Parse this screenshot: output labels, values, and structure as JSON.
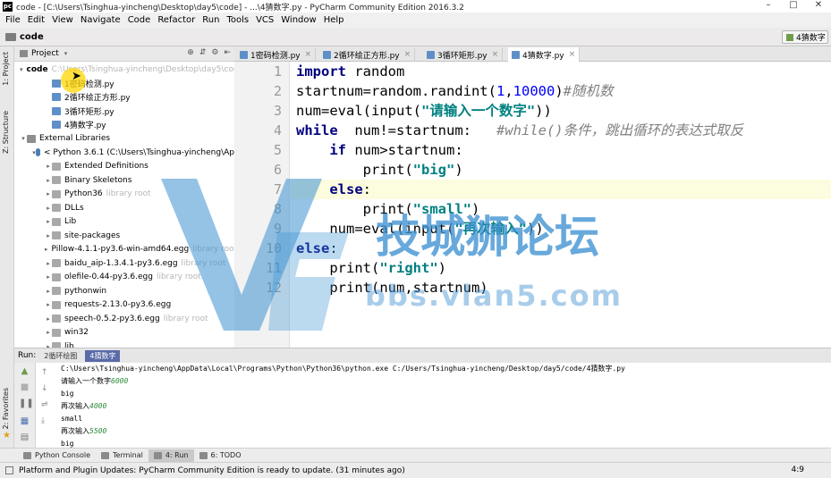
{
  "window": {
    "title": "code - [C:\\Users\\Tsinghua-yincheng\\Desktop\\day5\\code] - ...\\4猜数字.py - PyCharm Community Edition 2016.3.2",
    "app_icon": "pc"
  },
  "menu": [
    "File",
    "Edit",
    "View",
    "Navigate",
    "Code",
    "Refactor",
    "Run",
    "Tools",
    "VCS",
    "Window",
    "Help"
  ],
  "nav": {
    "crumb": "code",
    "run_config": "4猜数字"
  },
  "left_strip": {
    "project_tab": "1: Project",
    "structure_tab": "Z: Structure",
    "favorites_tab": "2: Favorites"
  },
  "project_panel": {
    "title": "Project",
    "tree": [
      {
        "label": "code",
        "extra": "C:\\Users\\Tsinghua-yincheng\\Desktop\\day5\\code",
        "indent": 0,
        "icon": "folder",
        "arrow": "▾",
        "bold": true
      },
      {
        "label": "1密码检测.py",
        "indent": 2,
        "icon": "py"
      },
      {
        "label": "2循环绘正方形.py",
        "indent": 2,
        "icon": "py"
      },
      {
        "label": "3循环矩形.py",
        "indent": 2,
        "icon": "py"
      },
      {
        "label": "4猜数字.py",
        "indent": 2,
        "icon": "py"
      },
      {
        "label": "External Libraries",
        "indent": 0,
        "icon": "lib",
        "arrow": "▾"
      },
      {
        "label": "< Python 3.6.1 (C:\\Users\\Tsinghua-yincheng\\Ap",
        "indent": 1,
        "icon": "pyt",
        "arrow": "▾"
      },
      {
        "label": "Extended Definitions",
        "indent": 2,
        "icon": "folder",
        "arrow": "▸"
      },
      {
        "label": "Binary Skeletons",
        "indent": 2,
        "icon": "folder",
        "arrow": "▸"
      },
      {
        "label": "Python36",
        "extra": "library root",
        "indent": 2,
        "icon": "folder",
        "arrow": "▸"
      },
      {
        "label": "DLLs",
        "indent": 2,
        "icon": "folder",
        "arrow": "▸"
      },
      {
        "label": "Lib",
        "indent": 2,
        "icon": "folder",
        "arrow": "▸"
      },
      {
        "label": "site-packages",
        "indent": 2,
        "icon": "folder",
        "arrow": "▸"
      },
      {
        "label": "Pillow-4.1.1-py3.6-win-amd64.egg",
        "extra": "library root",
        "indent": 2,
        "icon": "folder",
        "arrow": "▸"
      },
      {
        "label": "baidu_aip-1.3.4.1-py3.6.egg",
        "extra": "library root",
        "indent": 2,
        "icon": "folder",
        "arrow": "▸"
      },
      {
        "label": "olefile-0.44-py3.6.egg",
        "extra": "library root",
        "indent": 2,
        "icon": "folder",
        "arrow": "▸"
      },
      {
        "label": "pythonwin",
        "indent": 2,
        "icon": "folder",
        "arrow": "▸"
      },
      {
        "label": "requests-2.13.0-py3.6.egg",
        "indent": 2,
        "icon": "folder",
        "arrow": "▸"
      },
      {
        "label": "speech-0.5.2-py3.6.egg",
        "extra": "library root",
        "indent": 2,
        "icon": "folder",
        "arrow": "▸"
      },
      {
        "label": "win32",
        "indent": 2,
        "icon": "folder",
        "arrow": "▸"
      },
      {
        "label": "lib",
        "indent": 2,
        "icon": "folder",
        "arrow": "▸"
      }
    ]
  },
  "editor_tabs": [
    {
      "label": "1密码检测.py",
      "active": false
    },
    {
      "label": "2循环绘正方形.py",
      "active": false
    },
    {
      "label": "3循环矩形.py",
      "active": false
    },
    {
      "label": "4猜数字.py",
      "active": true
    }
  ],
  "editor": {
    "lines": [
      {
        "n": "1",
        "html": "<span class=\"kw\">import</span> random"
      },
      {
        "n": "2",
        "html": "startnum=random.randint(<span class=\"num\">1</span>,<span class=\"num\">10000</span>)<span class=\"cmt\">#随机数</span>"
      },
      {
        "n": "3",
        "html": "num=eval(input(<span class=\"str\">\"请输入一个数字\"</span>))"
      },
      {
        "n": "4",
        "html": "<span class=\"kw\">while</span>  num!=startnum:   <span class=\"cmt\">#while()条件，跳出循环的表达式取反</span>"
      },
      {
        "n": "5",
        "html": "    <span class=\"kw\">if</span> num>startnum:"
      },
      {
        "n": "6",
        "html": "        print(<span class=\"str\">\"big\"</span>)"
      },
      {
        "n": "7",
        "html": "    <span class=\"kw\">else</span>:"
      },
      {
        "n": "8",
        "html": "        print(<span class=\"str\">\"small\"</span>)"
      },
      {
        "n": "9",
        "html": "    num=eval(input(<span class=\"str\">\"再次输入\"</span>))"
      },
      {
        "n": "10",
        "html": "<span class=\"kw\">else</span>:"
      },
      {
        "n": "11",
        "html": "    print(<span class=\"str\">\"right\"</span>)"
      },
      {
        "n": "12",
        "html": "    print(num,startnum)"
      }
    ]
  },
  "watermark": {
    "cn": "技城狮论坛",
    "url": "bbs.vlan5.com"
  },
  "run_panel": {
    "label": "Run:",
    "tabs": [
      {
        "label": "2循环绘图",
        "active": false
      },
      {
        "label": "4猜数字",
        "active": true
      }
    ],
    "console": [
      {
        "text": "C:\\Users\\Tsinghua-yincheng\\AppData\\Local\\Programs\\Python\\Python36\\python.exe C:/Users/Tsinghua-yincheng/Desktop/day5/code/4猜数字.py",
        "input": ""
      },
      {
        "text": "请输入一个数字",
        "input": "6000"
      },
      {
        "text": "big",
        "input": ""
      },
      {
        "text": "再次输入",
        "input": "4000"
      },
      {
        "text": "small",
        "input": ""
      },
      {
        "text": "再次输入",
        "input": "5500"
      },
      {
        "text": "big",
        "input": ""
      }
    ]
  },
  "bottom_tabs": [
    {
      "label": "Python Console",
      "active": false
    },
    {
      "label": "Terminal",
      "active": false
    },
    {
      "label": "4: Run",
      "active": true
    },
    {
      "label": "6: TODO",
      "active": false
    }
  ],
  "status": {
    "message": "Platform and Plugin Updates: PyCharm Community Edition is ready to update. (31 minutes ago)",
    "caret": "4:9"
  }
}
